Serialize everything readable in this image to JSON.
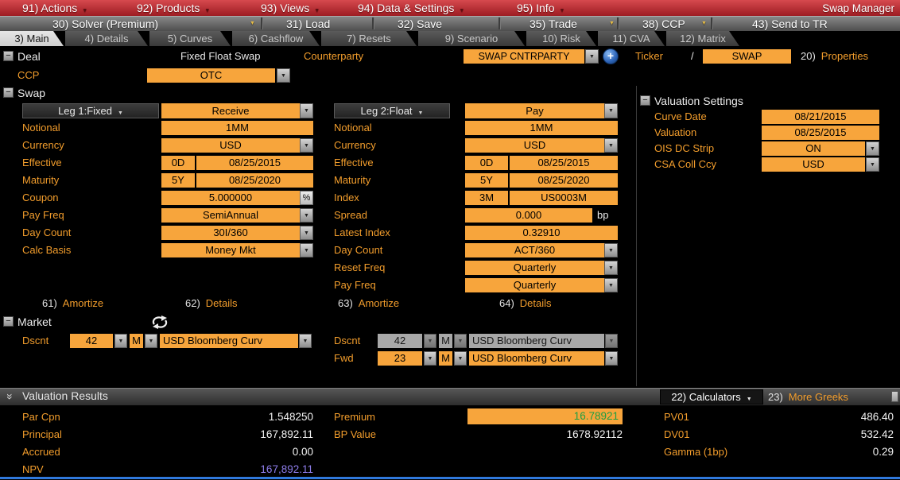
{
  "colors": {
    "accent_orange": "#f7a53c",
    "label_orange": "#f29d2c",
    "menubar_red": "#b3282d",
    "disabled_gray": "#a8a8a8",
    "premium_green": "#1d9e43",
    "npv_purple": "#8d7ce8",
    "bottom_line_blue": "#3079dc"
  },
  "menubar": {
    "items": [
      {
        "label": "91) Actions"
      },
      {
        "label": "92) Products"
      },
      {
        "label": "93) Views"
      },
      {
        "label": "94) Data & Settings"
      },
      {
        "label": "95) Info"
      }
    ],
    "app_title": "Swap Manager"
  },
  "toolbar": {
    "items": [
      {
        "label": "30) Solver (Premium)"
      },
      {
        "label": "31) Load"
      },
      {
        "label": "32) Save"
      },
      {
        "label": "35) Trade"
      },
      {
        "label": "38) CCP"
      },
      {
        "label": "43) Send to TR"
      }
    ]
  },
  "tabs": [
    {
      "label": "3) Main"
    },
    {
      "label": "4) Details"
    },
    {
      "label": "5) Curves"
    },
    {
      "label": "6) Cashflow"
    },
    {
      "label": "7) Resets"
    },
    {
      "label": "9) Scenario"
    },
    {
      "label": "10) Risk"
    },
    {
      "label": "11) CVA"
    },
    {
      "label": "12) Matrix"
    }
  ],
  "deal": {
    "section_title": "Deal",
    "type": "Fixed Float Swap",
    "counterparty_label": "Counterparty",
    "counterparty_value": "SWAP CNTRPARTY",
    "ticker_label": "Ticker",
    "ticker_separator": "/",
    "ticker_value": "SWAP",
    "properties_link": {
      "num": "20)",
      "label": "Properties"
    },
    "ccp_label": "CCP",
    "ccp_value": "OTC"
  },
  "swap": {
    "section_title": "Swap",
    "leg1": {
      "header": "Leg 1:Fixed",
      "direction": "Receive",
      "notional_label": "Notional",
      "notional": "1MM",
      "currency_label": "Currency",
      "currency": "USD",
      "effective_label": "Effective",
      "effective_tenor": "0D",
      "effective_date": "08/25/2015",
      "maturity_label": "Maturity",
      "maturity_tenor": "5Y",
      "maturity_date": "08/25/2020",
      "coupon_label": "Coupon",
      "coupon": "5.000000",
      "coupon_unit": "%",
      "pay_freq_label": "Pay Freq",
      "pay_freq": "SemiAnnual",
      "day_count_label": "Day Count",
      "day_count": "30I/360",
      "calc_basis_label": "Calc Basis",
      "calc_basis": "Money Mkt",
      "amortize_link": {
        "num": "61)",
        "label": "Amortize"
      },
      "details_link": {
        "num": "62)",
        "label": "Details"
      }
    },
    "leg2": {
      "header": "Leg 2:Float",
      "direction": "Pay",
      "notional_label": "Notional",
      "notional": "1MM",
      "currency_label": "Currency",
      "currency": "USD",
      "effective_label": "Effective",
      "effective_tenor": "0D",
      "effective_date": "08/25/2015",
      "maturity_label": "Maturity",
      "maturity_tenor": "5Y",
      "maturity_date": "08/25/2020",
      "index_label": "Index",
      "index_tenor": "3M",
      "index_value": "US0003M",
      "spread_label": "Spread",
      "spread": "0.000",
      "spread_unit": "bp",
      "latest_index_label": "Latest Index",
      "latest_index": "0.32910",
      "day_count_label": "Day Count",
      "day_count": "ACT/360",
      "reset_freq_label": "Reset Freq",
      "reset_freq": "Quarterly",
      "pay_freq_label": "Pay Freq",
      "pay_freq": "Quarterly",
      "amortize_link": {
        "num": "63)",
        "label": "Amortize"
      },
      "details_link": {
        "num": "64)",
        "label": "Details"
      }
    }
  },
  "valuation_settings": {
    "section_title": "Valuation Settings",
    "curve_date_label": "Curve Date",
    "curve_date": "08/21/2015",
    "valuation_label": "Valuation",
    "valuation_date": "08/25/2015",
    "ois_label": "OIS DC Strip",
    "ois": "ON",
    "csa_label": "CSA Coll Ccy",
    "csa": "USD"
  },
  "market": {
    "section_title": "Market",
    "leg1_dscnt": {
      "label": "Dscnt",
      "tenor": "42",
      "unit": "M",
      "curve": "USD Bloomberg Curv"
    },
    "leg2_dscnt": {
      "label": "Dscnt",
      "tenor": "42",
      "unit": "M",
      "curve": "USD Bloomberg Curv"
    },
    "leg2_fwd": {
      "label": "Fwd",
      "tenor": "23",
      "unit": "M",
      "curve": "USD Bloomberg Curv"
    }
  },
  "valuation_results": {
    "section_title": "Valuation Results",
    "calculators_button": "22) Calculators",
    "more_greeks_link": {
      "num": "23)",
      "label": "More Greeks"
    },
    "rows_left": [
      {
        "label": "Par Cpn",
        "value": "1.548250"
      },
      {
        "label": "Principal",
        "value": "167,892.11"
      },
      {
        "label": "Accrued",
        "value": "0.00"
      },
      {
        "label": "NPV",
        "value": "167,892.11"
      }
    ],
    "rows_mid": [
      {
        "label": "Premium",
        "value": "16.78921"
      },
      {
        "label": "BP Value",
        "value": "1678.92112"
      }
    ],
    "rows_right": [
      {
        "label": "PV01",
        "value": "486.40"
      },
      {
        "label": "DV01",
        "value": "532.42"
      },
      {
        "label": "Gamma (1bp)",
        "value": "0.29"
      }
    ]
  }
}
